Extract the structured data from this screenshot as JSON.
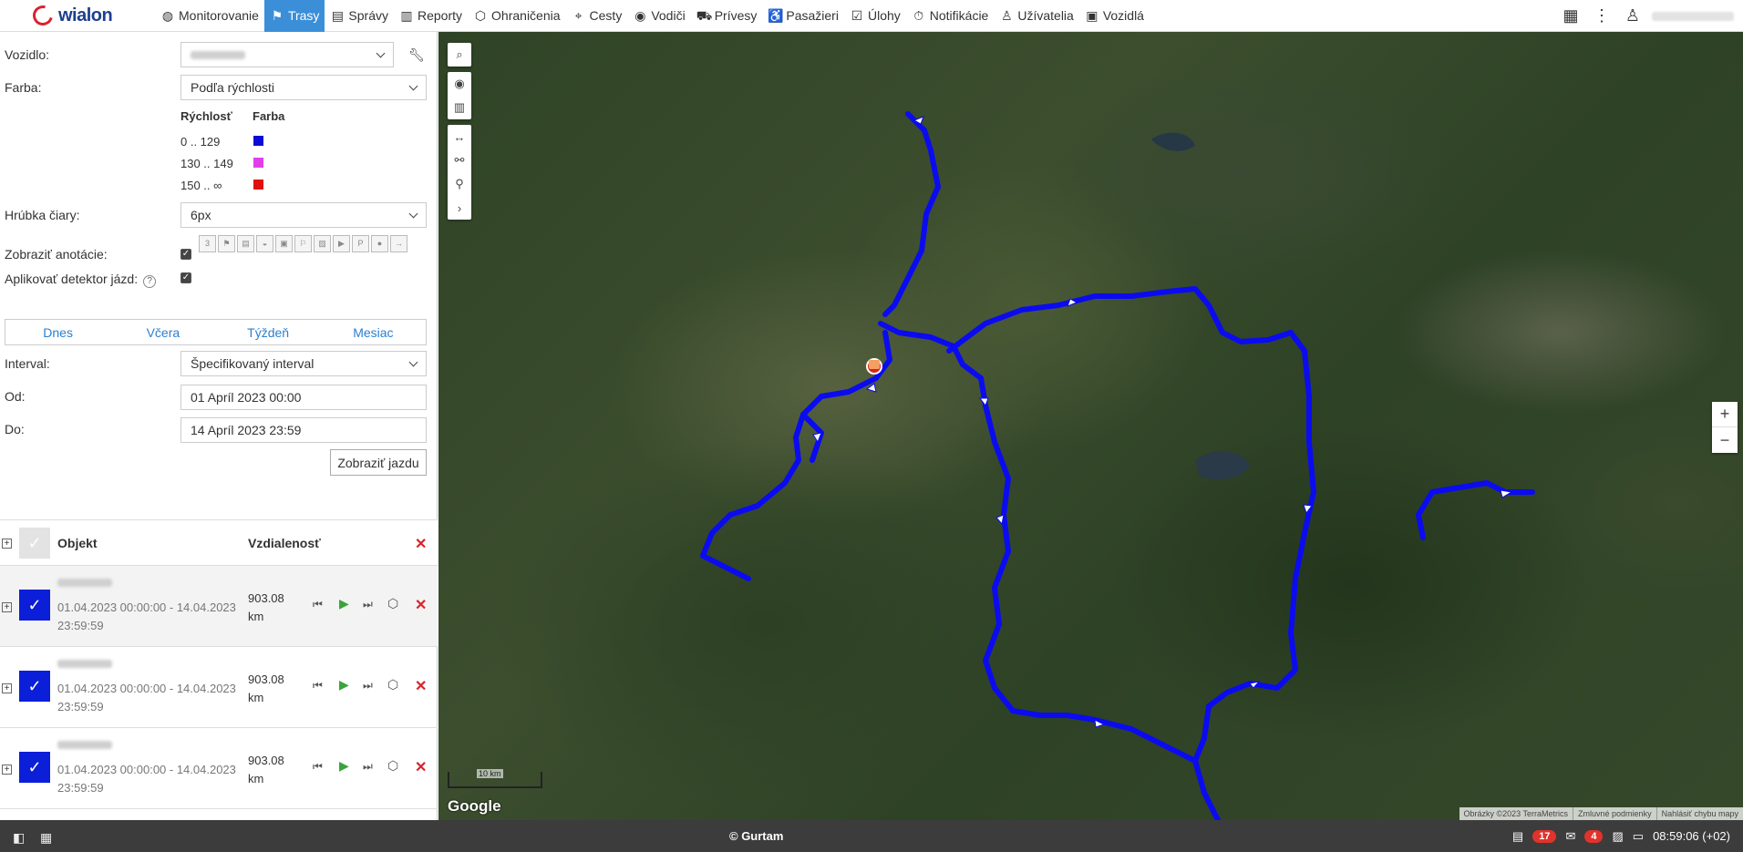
{
  "app": {
    "logo": "wialon"
  },
  "nav": [
    {
      "label": "Monitorovanie",
      "icon": "globe-icon",
      "glyph": "◍"
    },
    {
      "label": "Trasy",
      "icon": "flag-icon",
      "glyph": "⚑",
      "active": true
    },
    {
      "label": "Správy",
      "icon": "messages-icon",
      "glyph": "▤"
    },
    {
      "label": "Reporty",
      "icon": "report-icon",
      "glyph": "▥"
    },
    {
      "label": "Ohraničenia",
      "icon": "geofence-icon",
      "glyph": "⬡"
    },
    {
      "label": "Cesty",
      "icon": "routes-icon",
      "glyph": "⌖"
    },
    {
      "label": "Vodiči",
      "icon": "driver-icon",
      "glyph": "◉"
    },
    {
      "label": "Prívesy",
      "icon": "trailer-icon",
      "glyph": "⛟"
    },
    {
      "label": "Pasažieri",
      "icon": "passenger-icon",
      "glyph": "♿"
    },
    {
      "label": "Úlohy",
      "icon": "tasks-icon",
      "glyph": "☑"
    },
    {
      "label": "Notifikácie",
      "icon": "notification-icon",
      "glyph": "⏱"
    },
    {
      "label": "Užívatelia",
      "icon": "user-icon",
      "glyph": "♙"
    },
    {
      "label": "Vozidlá",
      "icon": "bus-icon",
      "glyph": "▣"
    }
  ],
  "form": {
    "vehicle_label": "Vozidlo:",
    "color_label": "Farba:",
    "color_value": "Podľa rýchlosti",
    "legend_speed_head": "Rýchlosť",
    "legend_color_head": "Farba",
    "legend": [
      {
        "range": "0 .. 129",
        "color": "#0b0bd8"
      },
      {
        "range": "130 .. 149",
        "color": "#e040e8"
      },
      {
        "range": "150 .. ∞",
        "color": "#e01010"
      }
    ],
    "line_width_label": "Hrúbka čiary:",
    "line_width_value": "6px",
    "show_annotations_label": "Zobraziť anotácie:",
    "apply_trip_detector_label": "Aplikovať detektor jázd:",
    "tabs": [
      "Dnes",
      "Včera",
      "Týždeň",
      "Mesiac"
    ],
    "interval_label": "Interval:",
    "interval_value": "Špecifikovaný interval",
    "from_label": "Od:",
    "from_value": "01 Apríl 2023 00:00",
    "to_label": "Do:",
    "to_value": "14 Apríl 2023 23:59",
    "show_trip_button": "Zobraziť jazdu"
  },
  "table": {
    "col_object": "Objekt",
    "col_distance": "Vzdialenosť",
    "rows": [
      {
        "dates": "01.04.2023 00:00:00 - 14.04.2023 23:59:59",
        "distance": "903.08 km"
      },
      {
        "dates": "01.04.2023 00:00:00 - 14.04.2023 23:59:59",
        "distance": "903.08 km"
      },
      {
        "dates": "01.04.2023 00:00:00 - 14.04.2023 23:59:59",
        "distance": "903.08 km"
      }
    ]
  },
  "map": {
    "scale_label": "10 km",
    "google_label": "Google",
    "attribution": [
      "Obrázky ©2023 TerraMetrics",
      "Zmluvné podmienky",
      "Nahlásiť chybu mapy"
    ],
    "track_color": "#0b0bf0"
  },
  "bottom": {
    "copyright": "© Gurtam",
    "notifications_count": "17",
    "messages_count": "4",
    "clock": "08:59:06 (+02)"
  }
}
